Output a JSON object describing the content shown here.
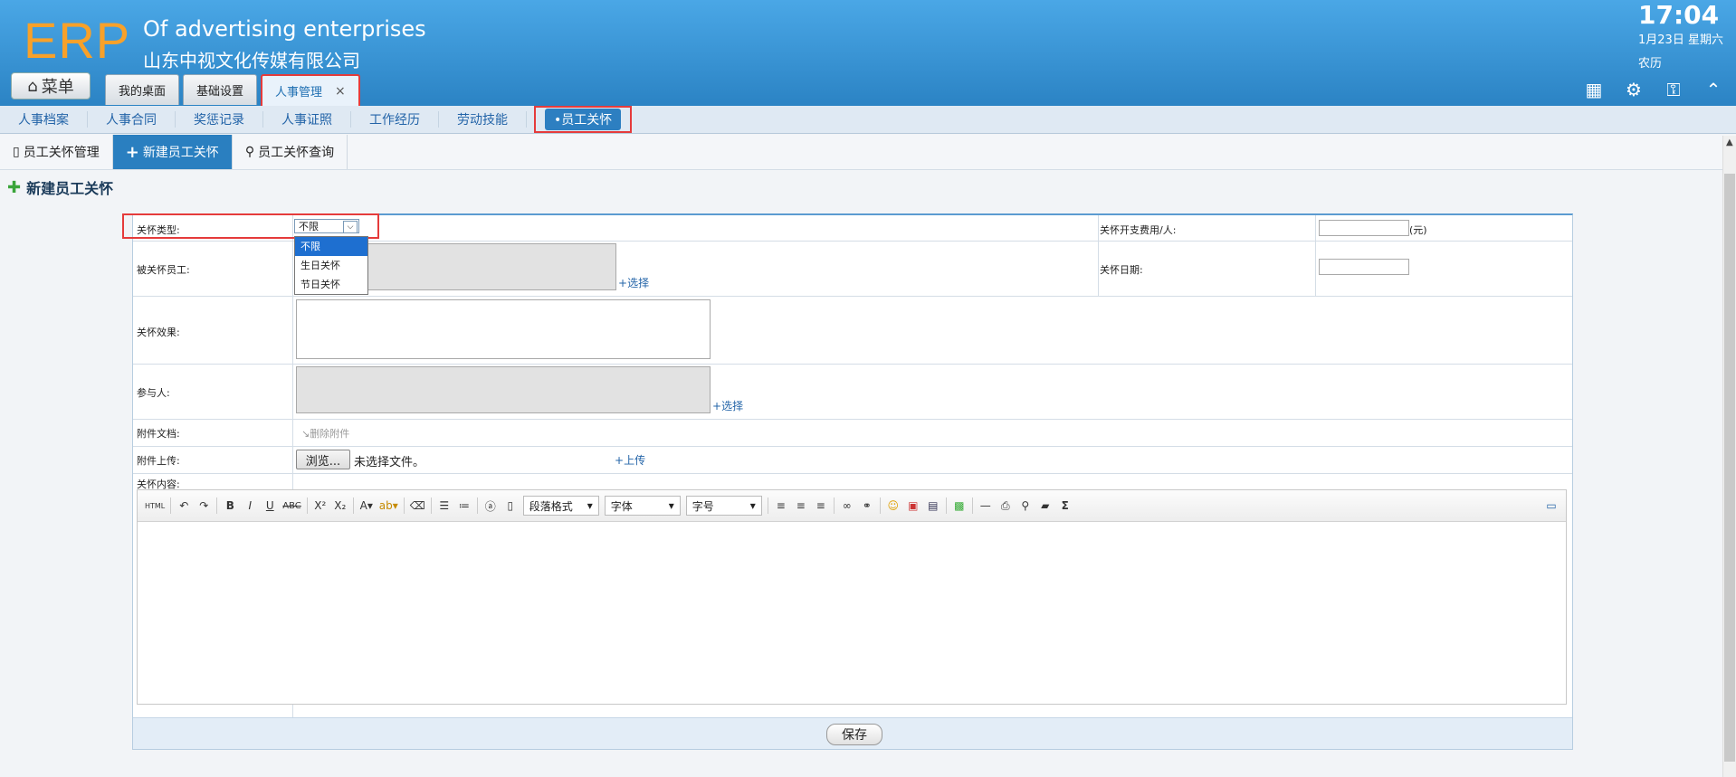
{
  "header": {
    "logo": "ERP",
    "company_en": "Of advertising enterprises",
    "company_cn": "山东中视文化传媒有限公司",
    "time": "17:04",
    "date": "1月23日 星期六",
    "lunar": "农历",
    "menu_label": "菜单",
    "tabs": [
      {
        "label": "我的桌面"
      },
      {
        "label": "基础设置"
      },
      {
        "label": "人事管理",
        "close": "×"
      }
    ]
  },
  "subnav": {
    "items": [
      "人事档案",
      "人事合同",
      "奖惩记录",
      "人事证照",
      "工作经历",
      "劳动技能"
    ],
    "active": "•员工关怀"
  },
  "actionbar": {
    "manage": "员工关怀管理",
    "new": "新建员工关怀",
    "query": "员工关怀查询"
  },
  "page_title": "新建员工关怀",
  "form": {
    "care_type_label": "关怀类型:",
    "care_type_value": "不限",
    "care_type_options": [
      "不限",
      "生日关怀",
      "节日关怀"
    ],
    "cost_label": "关怀开支费用/人:",
    "cost_unit": "(元)",
    "employee_label": "被关怀员工:",
    "select_link": "选择",
    "date_label": "关怀日期:",
    "effect_label": "关怀效果:",
    "participants_label": "参与人:",
    "attachment_label": "附件文档:",
    "delete_attachment": "删除附件",
    "upload_label": "附件上传:",
    "browse": "浏览...",
    "no_file": "未选择文件。",
    "upload_link": "上传",
    "content_label": "关怀内容:",
    "save": "保存"
  },
  "editor": {
    "paragraph": "段落格式",
    "font": "字体",
    "size": "字号"
  }
}
